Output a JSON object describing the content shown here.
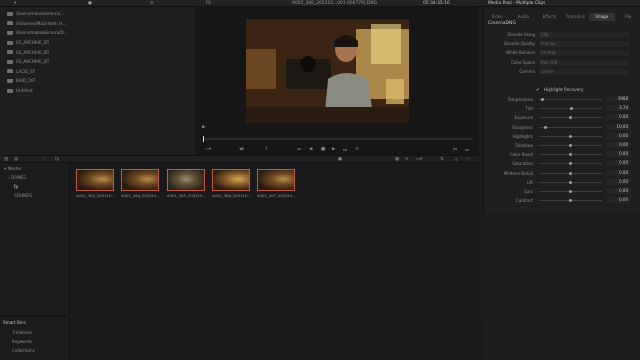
{
  "topbar": {
    "fit_label": "Fit",
    "clip_name": "A001_366_202310...001-000779].DNG",
    "timecode": "05:34:35:16",
    "panel_title": "Media Pool - Multiple Clips"
  },
  "folders": [
    "/Users/masaakimura/...",
    "/Volumes/Macintosh H...",
    "/Users/masaakimura/D...",
    "01_ARCHIVE_BT",
    "02_ARCHIVE_BT",
    "03_ARCHIVE_BT",
    "LACIE_ST",
    "RAID_16T",
    "Untitled"
  ],
  "viewer": {
    "frame_counter": "1"
  },
  "inspector": {
    "tabs": [
      {
        "label": "Video",
        "active": false
      },
      {
        "label": "Audio",
        "active": false
      },
      {
        "label": "Effects",
        "active": false
      },
      {
        "label": "Transition",
        "active": false
      },
      {
        "label": "Image",
        "active": true
      },
      {
        "label": "File",
        "active": false
      }
    ],
    "section_title": "CinemaDNG",
    "props": [
      {
        "label": "Decode Using",
        "value": "Clip"
      },
      {
        "label": "Decode Quality",
        "value": "Full res."
      },
      {
        "label": "White Balance",
        "value": "As shot"
      },
      {
        "label": "Color Space",
        "value": "Rec.709"
      },
      {
        "label": "Gamma",
        "value": "Linear"
      }
    ],
    "highlight_recovery": "Highlight Recovery",
    "sliders": [
      {
        "label": "Temperature",
        "value": "3988",
        "pos": 0.05
      },
      {
        "label": "Tint",
        "value": "3.74",
        "pos": 0.52
      },
      {
        "label": "Exposure",
        "value": "0.00",
        "pos": 0.5
      },
      {
        "label": "Sharpness",
        "value": "10.00",
        "pos": 0.1
      },
      {
        "label": "Highlights",
        "value": "0.00",
        "pos": 0.5
      },
      {
        "label": "Shadows",
        "value": "0.00",
        "pos": 0.5
      },
      {
        "label": "Color Boost",
        "value": "0.00",
        "pos": 0.5
      },
      {
        "label": "Saturation",
        "value": "0.00",
        "pos": 0.5
      },
      {
        "label": "Midtone Detail",
        "value": "0.00",
        "pos": 0.5
      },
      {
        "label": "Lift",
        "value": "0.00",
        "pos": 0.5
      },
      {
        "label": "Gain",
        "value": "0.00",
        "pos": 0.5
      },
      {
        "label": "Contrast",
        "value": "0.00",
        "pos": 0.5
      }
    ]
  },
  "bins": {
    "master": "Master",
    "sub1": "DOME1",
    "sub2": "fp",
    "sub3": "SOUNDS"
  },
  "clips": [
    "A001_363_202310...",
    "A001_364_202310...",
    "A001_365_202310...",
    "A001_366_202310...",
    "A001_367_202310..."
  ],
  "smart_bins": {
    "title": "Smart Bins",
    "items": [
      "Timelines",
      "Keywords",
      "Collections"
    ]
  },
  "colors": {
    "accent_active_clip": "#c05a3f"
  }
}
